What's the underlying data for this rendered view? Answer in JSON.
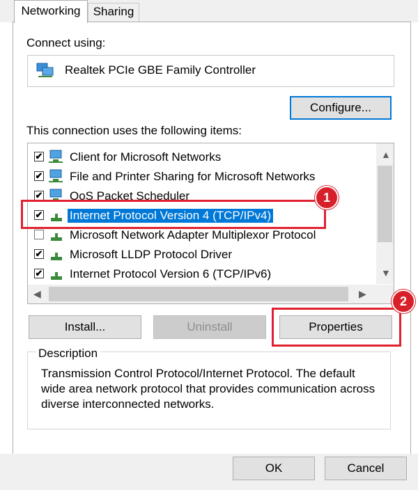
{
  "tabs": [
    {
      "label": "Networking",
      "active": true
    },
    {
      "label": "Sharing",
      "active": false
    }
  ],
  "connect_using": {
    "label": "Connect using:",
    "adapter": "Realtek PCIe GBE Family Controller",
    "adapter_icon": "network-adapter-icon"
  },
  "configure_label": "Configure...",
  "items_label": "This connection uses the following items:",
  "items": [
    {
      "label": "Client for Microsoft Networks",
      "checked": true,
      "icon": "network-client-icon"
    },
    {
      "label": "File and Printer Sharing for Microsoft Networks",
      "checked": true,
      "icon": "network-client-icon"
    },
    {
      "label": "QoS Packet Scheduler",
      "checked": true,
      "icon": "network-client-icon"
    },
    {
      "label": "Internet Protocol Version 4 (TCP/IPv4)",
      "checked": true,
      "selected": true,
      "icon": "protocol-icon"
    },
    {
      "label": "Microsoft Network Adapter Multiplexor Protocol",
      "checked": false,
      "icon": "protocol-icon"
    },
    {
      "label": "Microsoft LLDP Protocol Driver",
      "checked": true,
      "icon": "protocol-icon"
    },
    {
      "label": "Internet Protocol Version 6 (TCP/IPv6)",
      "checked": true,
      "icon": "protocol-icon"
    }
  ],
  "buttons": {
    "install": "Install...",
    "uninstall": "Uninstall",
    "properties": "Properties",
    "ok": "OK",
    "cancel": "Cancel"
  },
  "description": {
    "legend": "Description",
    "text": "Transmission Control Protocol/Internet Protocol. The default wide area network protocol that provides communication across diverse interconnected networks."
  },
  "annotations": {
    "step1": "1",
    "step2": "2",
    "highlight_color": "#e0202f"
  },
  "check_mark": "✔"
}
